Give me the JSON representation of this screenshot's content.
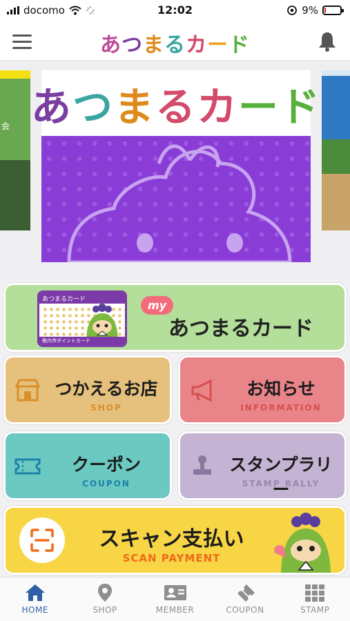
{
  "status_bar": {
    "carrier": "docomo",
    "time": "12:02",
    "battery": "9%",
    "battery_level": 0.09
  },
  "header": {
    "logo_text": [
      "あ",
      "つ",
      "ま",
      "る",
      "カ",
      "ー",
      "ド"
    ],
    "logo_colors": [
      "#c04a9a",
      "#7a3ea0",
      "#e08a1e",
      "#3aa5a0",
      "#d34a6a",
      "#f0a020",
      "#58b03c"
    ],
    "menu_icon": "hamburger-icon",
    "bell_icon": "bell-icon"
  },
  "carousel": {
    "prev_slide_text": "会",
    "main_title": [
      "あ",
      "つ",
      "ま",
      "る",
      "カ",
      "ー",
      "ド"
    ],
    "main_title_colors": [
      "#7a3ea0",
      "#3aa5a0",
      "#e08a1e",
      "#d34a6a",
      "#d34a6a",
      "#58b03c",
      "#58b03c"
    ]
  },
  "card_button": {
    "badge": "my",
    "label": "あつまるカード",
    "card_header": "あつまるカード",
    "card_footer": "稚内市ポイントカード"
  },
  "menu": {
    "shop": {
      "jp": "つかえるお店",
      "en": "SHOP",
      "icon": "store-icon"
    },
    "info": {
      "jp": "お知らせ",
      "en": "INFORMATION",
      "icon": "megaphone-icon"
    },
    "coupon": {
      "jp": "クーポン",
      "en": "COUPON",
      "icon": "ticket-icon"
    },
    "stamp": {
      "jp": "スタンプラリー",
      "en": "STAMP RALLY",
      "icon": "stamp-icon"
    },
    "scan": {
      "jp": "スキャン支払い",
      "en": "SCAN PAYMENT",
      "icon": "scan-icon"
    }
  },
  "tabs": [
    {
      "label": "HOME",
      "icon": "home-icon",
      "active": true
    },
    {
      "label": "SHOP",
      "icon": "map-pin-icon",
      "active": false
    },
    {
      "label": "MEMBER",
      "icon": "member-card-icon",
      "active": false
    },
    {
      "label": "COUPON",
      "icon": "ticket-icon",
      "active": false
    },
    {
      "label": "STAMP",
      "icon": "grid-icon",
      "active": false
    }
  ]
}
